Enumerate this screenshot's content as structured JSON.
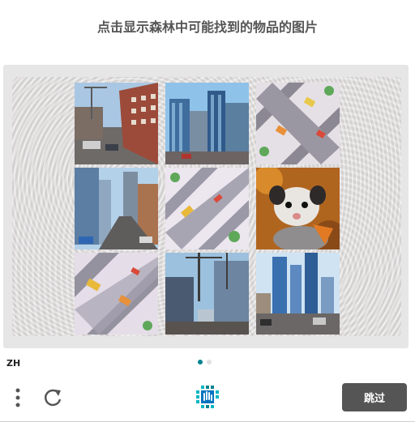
{
  "prompt": "点击显示森林中可能找到的物品的图片",
  "language": "ZH",
  "skip_label": "跳过",
  "tiles": [
    {
      "id": "construction-street"
    },
    {
      "id": "city-skyscrapers"
    },
    {
      "id": "isometric-intersection"
    },
    {
      "id": "city-street-towers"
    },
    {
      "id": "isometric-roads"
    },
    {
      "id": "opossum"
    },
    {
      "id": "isometric-traffic"
    },
    {
      "id": "construction-site"
    },
    {
      "id": "city-skyline-street"
    }
  ],
  "pagination": {
    "pages": 2,
    "current": 1
  },
  "colors": {
    "accent": "#00838f",
    "button": "#555555",
    "panel": "#e6e6e6"
  },
  "icons": {
    "menu": "more-vertical-icon",
    "refresh": "refresh-icon",
    "logo": "hcaptcha-logo-icon"
  }
}
